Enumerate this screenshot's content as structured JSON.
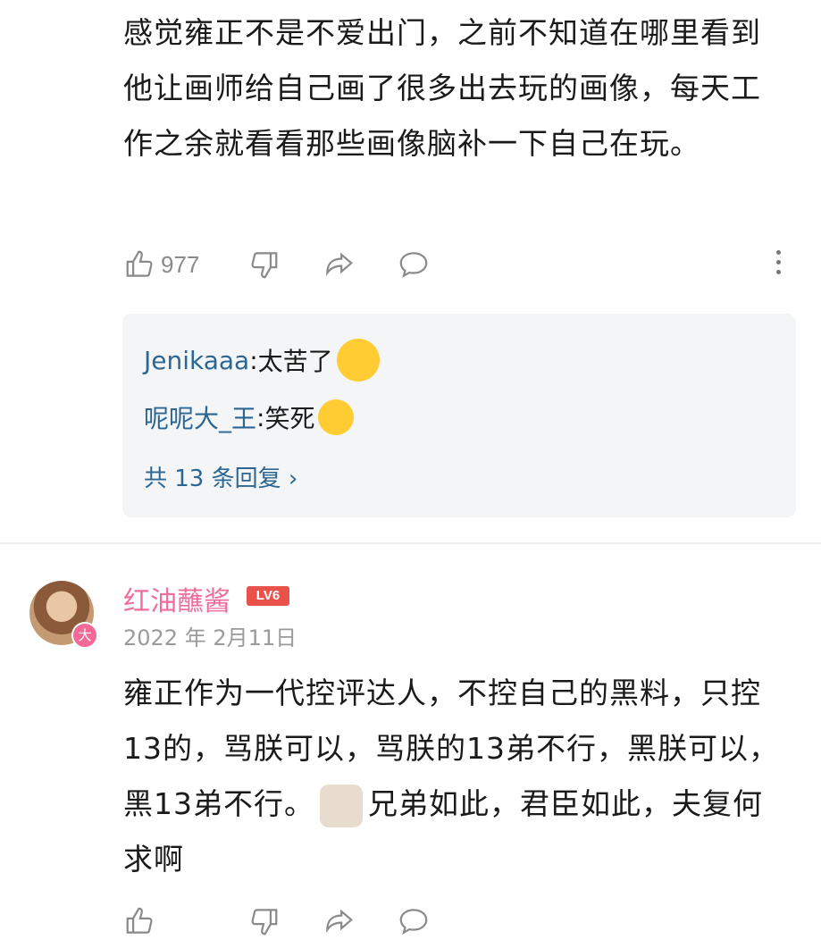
{
  "comment1": {
    "text": "感觉雍正不是不爱出门，之前不知道在哪里看到他让画师给自己画了很多出去玩的画像，每天工作之余就看看那些画像脑补一下自己在玩。",
    "like_count": "977"
  },
  "replies": [
    {
      "user": "Jenikaaa",
      "sep": ": ",
      "text": "太苦了",
      "emoji": "crying-laugh-emoji"
    },
    {
      "user": "呢呢大_王",
      "sep": ": ",
      "text": "笑死",
      "emoji": "grinning-squint-emoji"
    }
  ],
  "more_replies": "共 13 条回复 ›",
  "comment2": {
    "username": "红油蘸酱",
    "level": "LV6",
    "avatar_badge": "大",
    "date": "2022 年 2月11日",
    "text_part1": "雍正作为一代控评达人，不控自己的黑料，只控13的，骂朕可以，骂朕的13弟不行，黑朕可以，黑13弟不行。",
    "text_part2": "兄弟如此，君臣如此，夫复何求啊"
  },
  "colors": {
    "link": "#2c6693",
    "username": "#f06c9b",
    "level": "#e8524a"
  }
}
